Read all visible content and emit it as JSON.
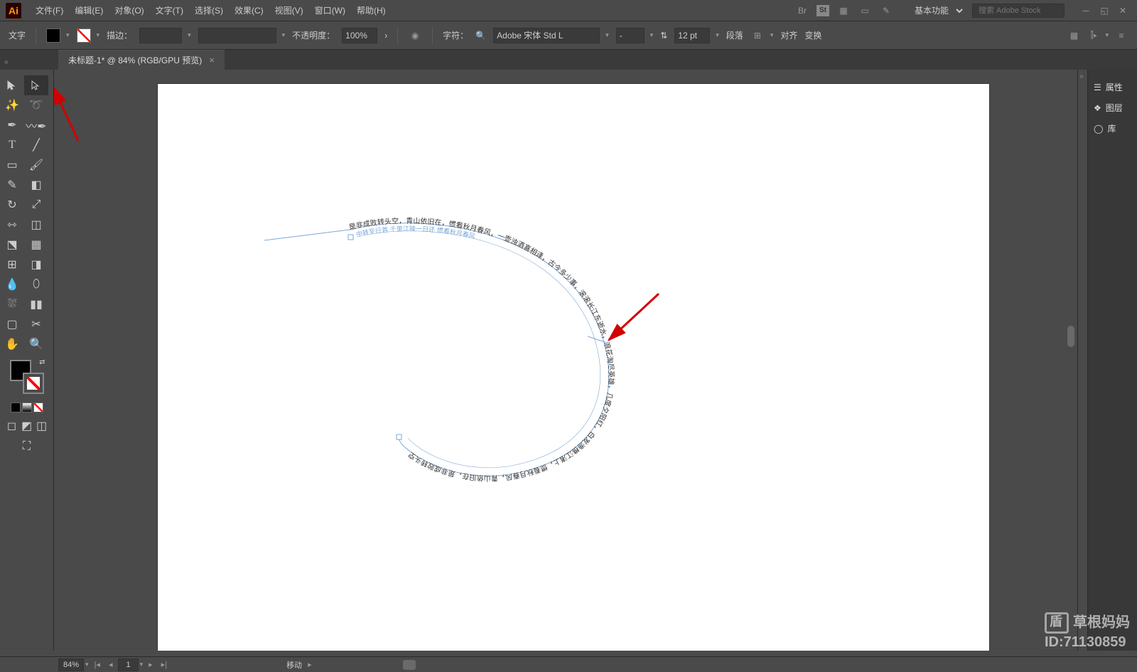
{
  "app": {
    "icon_text": "Ai"
  },
  "menu": [
    "文件(F)",
    "编辑(E)",
    "对象(O)",
    "文字(T)",
    "选择(S)",
    "效果(C)",
    "视图(V)",
    "窗口(W)",
    "帮助(H)"
  ],
  "workspace": {
    "label": "基本功能",
    "search_placeholder": "搜索 Adobe Stock"
  },
  "options": {
    "tool_name": "文字",
    "stroke_label": "描边：",
    "stroke_weight": "",
    "opacity_label": "不透明度：",
    "opacity_value": "100%",
    "char_label": "字符：",
    "font_name": "Adobe 宋体 Std L",
    "font_style": "-",
    "font_size": "12 pt",
    "para_label": "段落",
    "align_label": "对齐",
    "transform_label": "变换"
  },
  "tab": {
    "title": "未标题-1* @ 84% (RGB/GPU 预览)"
  },
  "right_panels": [
    "属性",
    "图层",
    "库"
  ],
  "status": {
    "zoom": "84%",
    "artboard": "1",
    "tool": "移动"
  },
  "canvas": {
    "path_text": "是非成败转头空，青山依旧在，惯看秋月春风，一壶浊酒喜相逢，古今多少事，滚滚长江东逝水，浪花淘尽英雄，几度夕阳红，白发渔樵江渚上，惯看秋月春风，青山依旧在，是非成败转头空",
    "path_text_inner": "中转至行首    千里江陵一日还    惯看秋月春风"
  },
  "watermark": {
    "line1": "草根妈妈",
    "line2": "ID:71130859"
  }
}
